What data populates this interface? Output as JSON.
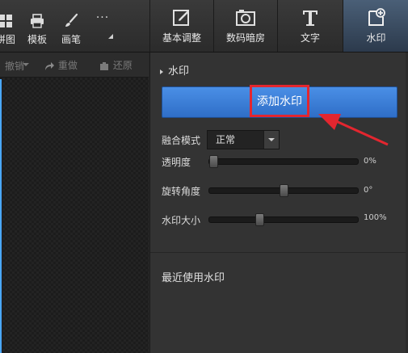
{
  "toolbar": {
    "tools": [
      {
        "label": "拼图",
        "icon": "grid-icon"
      },
      {
        "label": "模板",
        "icon": "printer-icon"
      },
      {
        "label": "画笔",
        "icon": "brush-icon"
      },
      {
        "label": "...",
        "icon": "more-icon"
      }
    ],
    "tabs": [
      {
        "label": "基本调整",
        "icon": "edit-icon"
      },
      {
        "label": "数码暗房",
        "icon": "camera-icon"
      },
      {
        "label": "文字",
        "icon": "text-icon"
      },
      {
        "label": "水印",
        "icon": "watermark-icon",
        "active": true
      }
    ]
  },
  "history": {
    "undo_label": "撤销",
    "redo_label": "重做",
    "restore_label": "还原"
  },
  "panel": {
    "section_title": "水印",
    "add_button_label": "添加水印",
    "blend_label": "融合模式",
    "blend_value": "正常",
    "opacity_label": "透明度",
    "opacity_value": "0%",
    "opacity_level": 0,
    "rotation_label": "旋转角度",
    "rotation_value": "0°",
    "rotation_level": 0.5,
    "size_label": "水印大小",
    "size_value": "100%",
    "size_level": 0.33,
    "recent_label": "最近使用水印"
  },
  "colors": {
    "accent": "#3b7fd9",
    "highlight": "#e3262f"
  }
}
